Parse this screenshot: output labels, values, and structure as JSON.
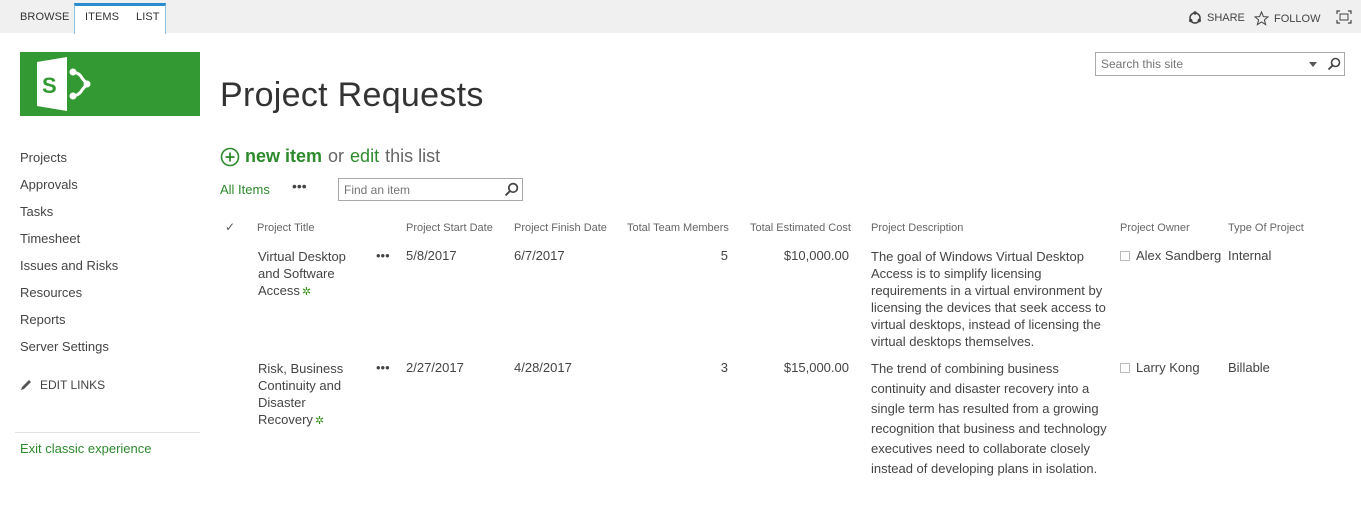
{
  "ribbon": {
    "tabs": [
      "BROWSE",
      "ITEMS",
      "LIST"
    ],
    "share_label": "SHARE",
    "follow_label": "FOLLOW"
  },
  "site": {
    "search_placeholder": "Search this site"
  },
  "page": {
    "title": "Project Requests"
  },
  "nav": {
    "items": [
      "Projects",
      "Approvals",
      "Tasks",
      "Timesheet",
      "Issues and Risks",
      "Resources",
      "Reports",
      "Server Settings"
    ],
    "edit_links": "EDIT LINKS",
    "exit_classic": "Exit classic experience"
  },
  "actions": {
    "new_item": "new item",
    "or": "or",
    "edit": "edit",
    "this_list": "this list",
    "view_name": "All Items",
    "view_more": "•••",
    "find_placeholder": "Find an item"
  },
  "table": {
    "columns": [
      "Project Title",
      "Project Start Date",
      "Project Finish Date",
      "Total Team Members",
      "Total Estimated Cost",
      "Project Description",
      "Project Owner",
      "Type Of Project"
    ],
    "check_glyph": "✓",
    "rows": [
      {
        "title": "Virtual Desktop and Software Access",
        "new_badge": "✲",
        "menu": "•••",
        "start": "5/8/2017",
        "finish": "6/7/2017",
        "team": "5",
        "cost": "$10,000.00",
        "description": "The goal of Windows Virtual Desktop Access is to simplify licensing requirements in a virtual environment by licensing the devices that seek access to virtual desktops, instead of licensing the virtual desktops themselves.",
        "owner": "Alex Sandberg",
        "type": "Internal"
      },
      {
        "title": "Risk, Business Continuity and Disaster Recovery",
        "new_badge": "✲",
        "menu": "•••",
        "start": "2/27/2017",
        "finish": "4/28/2017",
        "team": "3",
        "cost": "$15,000.00",
        "description": "The trend of combining business continuity and disaster recovery into a single term has resulted from a growing recognition that business and technology executives need to collaborate closely instead of developing plans in isolation.",
        "owner": "Larry Kong",
        "type": "Billable"
      }
    ]
  },
  "colors": {
    "brand_green": "#339933",
    "link_green": "#2d8a2d",
    "ribbon_bg": "#f0f0f0",
    "tab_accent": "#2a8dd4"
  }
}
